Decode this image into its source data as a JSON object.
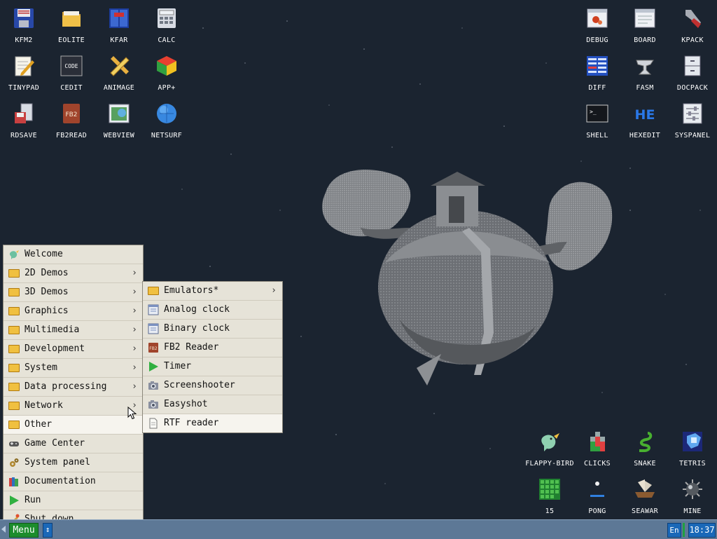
{
  "desktop": {
    "icons_left": [
      {
        "label": "KFM2",
        "icon": "floppy-icon"
      },
      {
        "label": "EOLITE",
        "icon": "folder-icon"
      },
      {
        "label": "KFAR",
        "icon": "kfar-icon"
      },
      {
        "label": "CALC",
        "icon": "calculator-icon"
      },
      {
        "label": "TINYPAD",
        "icon": "notepad-icon"
      },
      {
        "label": "CEDIT",
        "icon": "code-icon"
      },
      {
        "label": "ANIMAGE",
        "icon": "pencil-ruler-icon"
      },
      {
        "label": "APP+",
        "icon": "rubik-cube-icon"
      },
      {
        "label": "RDSAVE",
        "icon": "rdsave-icon"
      },
      {
        "label": "FB2READ",
        "icon": "book-icon"
      },
      {
        "label": "WEBVIEW",
        "icon": "webview-icon"
      },
      {
        "label": "NETSURF",
        "icon": "globe-icon"
      }
    ],
    "icons_right": [
      {
        "label": "DEBUG",
        "icon": "debug-icon"
      },
      {
        "label": "BOARD",
        "icon": "board-icon"
      },
      {
        "label": "KPACK",
        "icon": "wrench-icon"
      },
      {
        "label": "DIFF",
        "icon": "diff-icon"
      },
      {
        "label": "FASM",
        "icon": "anvil-icon"
      },
      {
        "label": "DOCPACK",
        "icon": "cabinet-icon"
      },
      {
        "label": "SHELL",
        "icon": "terminal-icon"
      },
      {
        "label": "HEXEDIT",
        "icon": "hex-icon"
      },
      {
        "label": "SYSPANEL",
        "icon": "sliders-icon"
      }
    ],
    "icons_games": [
      {
        "label": "FLAPPY-BIRD",
        "icon": "bird-icon"
      },
      {
        "label": "CLICKS",
        "icon": "blocks-icon"
      },
      {
        "label": "SNAKE",
        "icon": "snake-icon"
      },
      {
        "label": "TETRIS",
        "icon": "tetris-icon"
      },
      {
        "label": "15",
        "icon": "grid-15-icon"
      },
      {
        "label": "PONG",
        "icon": "pong-icon"
      },
      {
        "label": "SEAWAR",
        "icon": "ship-icon"
      },
      {
        "label": "MINE",
        "icon": "mine-icon"
      }
    ]
  },
  "main_menu": {
    "items": [
      {
        "label": "Welcome",
        "icon": "bird-icon",
        "submenu": false
      },
      {
        "label": "2D Demos",
        "icon": "folder-icon",
        "submenu": true
      },
      {
        "label": "3D Demos",
        "icon": "folder-icon",
        "submenu": true
      },
      {
        "label": "Graphics",
        "icon": "folder-icon",
        "submenu": true
      },
      {
        "label": "Multimedia",
        "icon": "folder-icon",
        "submenu": true
      },
      {
        "label": "Development",
        "icon": "folder-icon",
        "submenu": true
      },
      {
        "label": "System",
        "icon": "folder-icon",
        "submenu": true
      },
      {
        "label": "Data processing",
        "icon": "folder-icon",
        "submenu": true
      },
      {
        "label": "Network",
        "icon": "folder-icon",
        "submenu": true
      },
      {
        "label": "Other",
        "icon": "folder-icon",
        "submenu": false,
        "highlighted": true
      },
      {
        "label": "Game Center",
        "icon": "gamepad-icon",
        "submenu": false
      },
      {
        "label": "System panel",
        "icon": "gears-icon",
        "submenu": false
      },
      {
        "label": "Documentation",
        "icon": "books-icon",
        "submenu": false
      },
      {
        "label": "Run",
        "icon": "play-icon",
        "submenu": false
      },
      {
        "label": "Shut down",
        "icon": "shutdown-icon",
        "submenu": false
      }
    ]
  },
  "sub_menu": {
    "items": [
      {
        "label": "Emulators*",
        "icon": "folder-icon",
        "submenu": true
      },
      {
        "label": "Analog clock",
        "icon": "window-icon",
        "submenu": false
      },
      {
        "label": "Binary clock",
        "icon": "window-icon",
        "submenu": false
      },
      {
        "label": "FB2 Reader",
        "icon": "fb2-icon",
        "submenu": false
      },
      {
        "label": "Timer",
        "icon": "play-icon",
        "submenu": false
      },
      {
        "label": "Screenshooter",
        "icon": "camera-icon",
        "submenu": false
      },
      {
        "label": "Easyshot",
        "icon": "camera-icon",
        "submenu": false
      },
      {
        "label": "RTF reader",
        "icon": "document-icon",
        "submenu": false,
        "highlighted": true
      }
    ]
  },
  "taskbar": {
    "menu_label": "Menu",
    "toggle_glyph": "↕",
    "lang": "En",
    "clock": "18:37"
  }
}
